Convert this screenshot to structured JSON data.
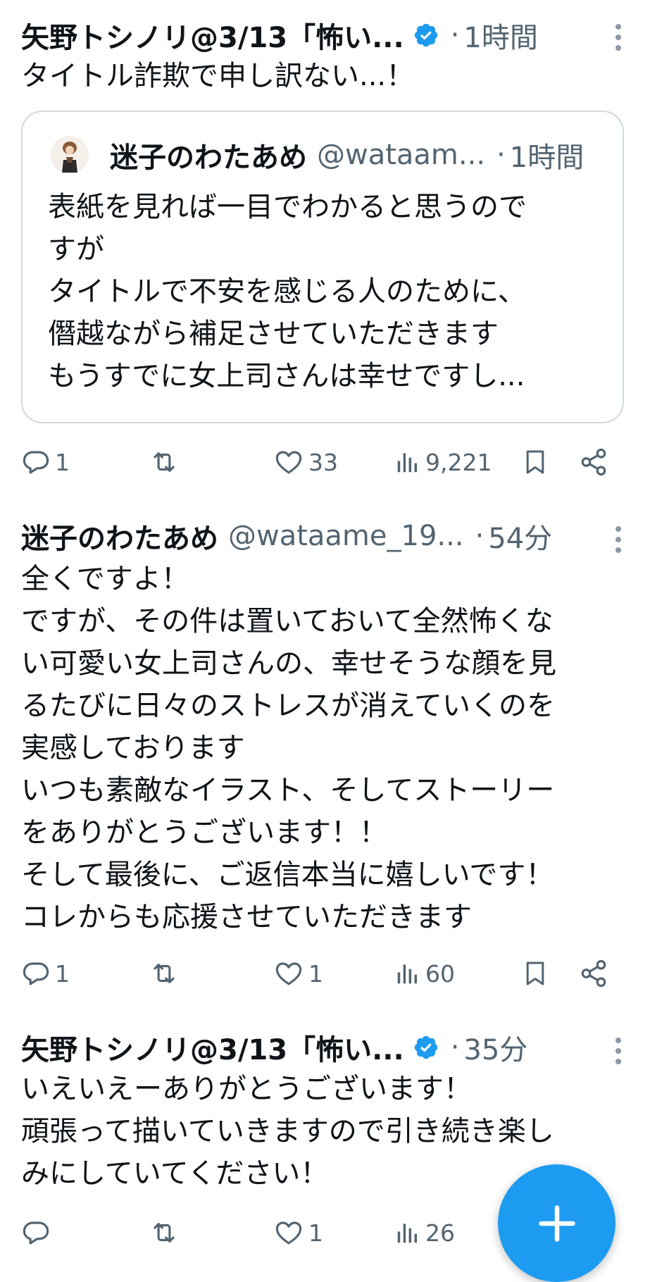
{
  "tweets": [
    {
      "name": "矢野トシノリ@3/13「怖い...",
      "verified": true,
      "time": "1時間",
      "body": "タイトル詐欺で申し訳ない...！",
      "quote": {
        "name": "迷子のわたあめ",
        "handle": "@wataam...",
        "time": "1時間",
        "body": "表紙を見れば一目でわかると思うので\nすが\nタイトルで不安を感じる人のために、\n僭越ながら補足させていただきます\nもうすでに女上司さんは幸せですし..."
      },
      "replies": "1",
      "retweets": "",
      "likes": "33",
      "views": "9,221"
    },
    {
      "name": "迷子のわたあめ",
      "handle": "@wataame_19...",
      "time": "54分",
      "body": "全くですよ！\nですが、その件は置いておいて全然怖くな\nい可愛い女上司さんの、幸せそうな顔を見\nるたびに日々のストレスが消えていくのを\n実感しております\nいつも素敵なイラスト、そしてストーリー\nをありがとうございます！！\nそして最後に、ご返信本当に嬉しいです！\nコレからも応援させていただきます",
      "replies": "1",
      "retweets": "",
      "likes": "1",
      "views": "60"
    },
    {
      "name": "矢野トシノリ@3/13「怖い...",
      "verified": true,
      "time": "35分",
      "body": "いえいえーありがとうございます！\n頑張って描いていきますので引き続き楽し\nみにしていてください！",
      "replies": "",
      "retweets": "",
      "likes": "1",
      "views": "26"
    }
  ],
  "dot_separator": "·",
  "colors": {
    "accent": "#1d9bf0",
    "text": "#0f1419",
    "muted": "#536471",
    "border": "#cfd9de"
  },
  "icons": [
    "verified-badge-icon",
    "more-icon",
    "reply-icon",
    "retweet-icon",
    "like-icon",
    "views-icon",
    "bookmark-icon",
    "share-icon",
    "compose-plus-icon"
  ]
}
